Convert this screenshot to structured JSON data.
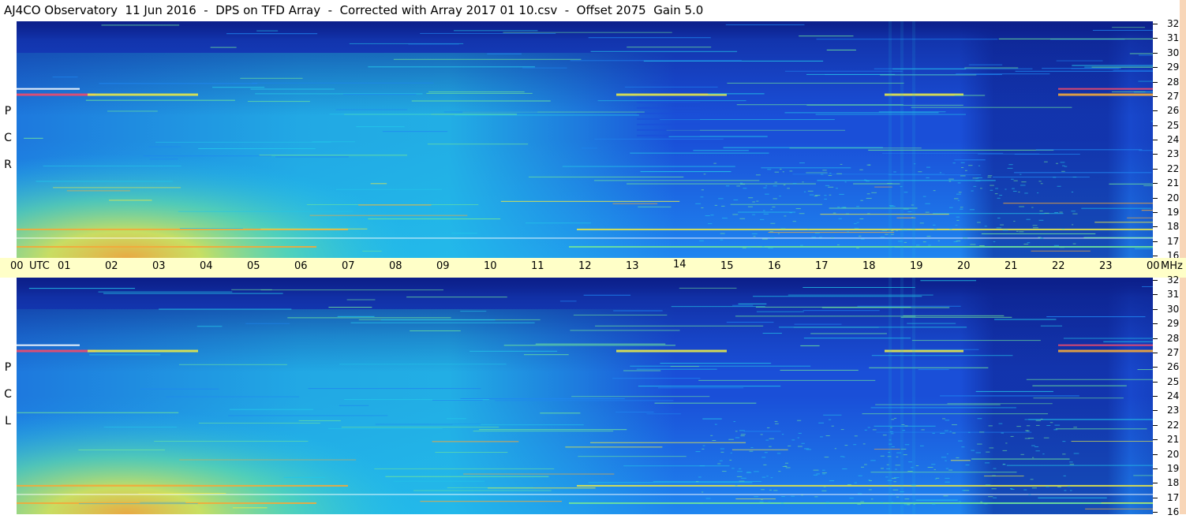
{
  "title": "AJ4CO Observatory  11 Jun 2016  -  DPS on TFD Array  -  Corrected with Array 2017 01 10.csv  -  Offset 2075  Gain 5.0",
  "chart_data": [
    {
      "type": "heatmap",
      "panel": "RCP",
      "polarization_label": [
        "R",
        "C",
        "P"
      ],
      "x_ticks": [
        "00",
        "01",
        "02",
        "03",
        "04",
        "05",
        "06",
        "07",
        "08",
        "09",
        "10",
        "11",
        "12",
        "13",
        "14",
        "15",
        "16",
        "17",
        "18",
        "19",
        "20",
        "21",
        "22",
        "23",
        "00"
      ],
      "x_unit": "UTC",
      "y_ticks": [
        32,
        31,
        30,
        29,
        28,
        27,
        26,
        25,
        24,
        23,
        22,
        21,
        20,
        19,
        18,
        17,
        16
      ],
      "y_unit": "MHz",
      "xlim": [
        0,
        24
      ],
      "ylim": [
        16,
        32
      ],
      "colormap": [
        "#0c1f8a",
        "#1a4fd8",
        "#1f86f0",
        "#24c6e8",
        "#6fe69a",
        "#e6e84a",
        "#f3a93a",
        "#f04a6a",
        "#ffffff"
      ]
    },
    {
      "type": "heatmap",
      "panel": "LCP",
      "polarization_label": [
        "L",
        "C",
        "P"
      ],
      "x_ticks": [
        "00",
        "01",
        "02",
        "03",
        "04",
        "05",
        "06",
        "07",
        "08",
        "09",
        "10",
        "11",
        "12",
        "13",
        "14",
        "15",
        "16",
        "17",
        "18",
        "19",
        "20",
        "21",
        "22",
        "23",
        "00"
      ],
      "x_unit": "UTC",
      "y_ticks": [
        32,
        31,
        30,
        29,
        28,
        27,
        26,
        25,
        24,
        23,
        22,
        21,
        20,
        19,
        18,
        17,
        16
      ],
      "y_unit": "MHz",
      "xlim": [
        0,
        24
      ],
      "ylim": [
        16,
        32
      ],
      "colormap": [
        "#0c1f8a",
        "#1a4fd8",
        "#1f86f0",
        "#24c6e8",
        "#6fe69a",
        "#e6e84a",
        "#f3a93a",
        "#f04a6a",
        "#ffffff"
      ]
    }
  ],
  "time_axis": {
    "ticks": [
      "00",
      "01",
      "02",
      "03",
      "04",
      "05",
      "06",
      "07",
      "08",
      "09",
      "10",
      "11",
      "12",
      "13",
      "14",
      "15",
      "16",
      "17",
      "18",
      "19",
      "20",
      "21",
      "22",
      "23",
      "00"
    ],
    "utc_label": "UTC",
    "mhz_label": "MHz"
  }
}
